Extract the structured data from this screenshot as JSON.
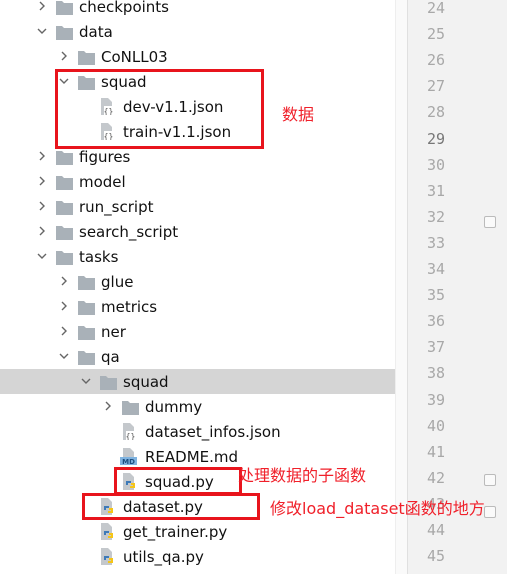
{
  "tree": [
    {
      "label": "checkpoints",
      "type": "folder",
      "level": 0,
      "expanded": false
    },
    {
      "label": "data",
      "type": "folder",
      "level": 0,
      "expanded": true
    },
    {
      "label": "CoNLL03",
      "type": "folder",
      "level": 1,
      "expanded": false
    },
    {
      "label": "squad",
      "type": "folder",
      "level": 1,
      "expanded": true
    },
    {
      "label": "dev-v1.1.json",
      "type": "json",
      "level": 2
    },
    {
      "label": "train-v1.1.json",
      "type": "json",
      "level": 2
    },
    {
      "label": "figures",
      "type": "folder",
      "level": 0,
      "expanded": false
    },
    {
      "label": "model",
      "type": "folder",
      "level": 0,
      "expanded": false
    },
    {
      "label": "run_script",
      "type": "folder",
      "level": 0,
      "expanded": false
    },
    {
      "label": "search_script",
      "type": "folder",
      "level": 0,
      "expanded": false
    },
    {
      "label": "tasks",
      "type": "folder",
      "level": 0,
      "expanded": true
    },
    {
      "label": "glue",
      "type": "folder",
      "level": 1,
      "expanded": false
    },
    {
      "label": "metrics",
      "type": "folder",
      "level": 1,
      "expanded": false
    },
    {
      "label": "ner",
      "type": "folder",
      "level": 1,
      "expanded": false
    },
    {
      "label": "qa",
      "type": "folder",
      "level": 1,
      "expanded": true
    },
    {
      "label": "squad",
      "type": "folder",
      "level": 2,
      "expanded": true,
      "selected": true
    },
    {
      "label": "dummy",
      "type": "folder",
      "level": 3,
      "expanded": false
    },
    {
      "label": "dataset_infos.json",
      "type": "json",
      "level": 3
    },
    {
      "label": "README.md",
      "type": "md",
      "level": 3
    },
    {
      "label": "squad.py",
      "type": "python",
      "level": 3
    },
    {
      "label": "dataset.py",
      "type": "python",
      "level": 2
    },
    {
      "label": "get_trainer.py",
      "type": "python",
      "level": 2
    },
    {
      "label": "utils_qa.py",
      "type": "python",
      "level": 2
    }
  ],
  "line_numbers": [
    "24",
    "25",
    "26",
    "27",
    "28",
    "29",
    "30",
    "31",
    "32",
    "33",
    "34",
    "35",
    "36",
    "37",
    "38",
    "39",
    "40",
    "41",
    "42",
    "43",
    "44",
    "45"
  ],
  "current_line": "29",
  "annotations": {
    "data_note": "数据",
    "squad_note": "处理数据的子函数",
    "dataset_note": "修改load_dataset函数的地方"
  },
  "colors": {
    "annotation": "#e8141c",
    "selection": "#d5d5d5",
    "folder": "#a9b1b8"
  }
}
